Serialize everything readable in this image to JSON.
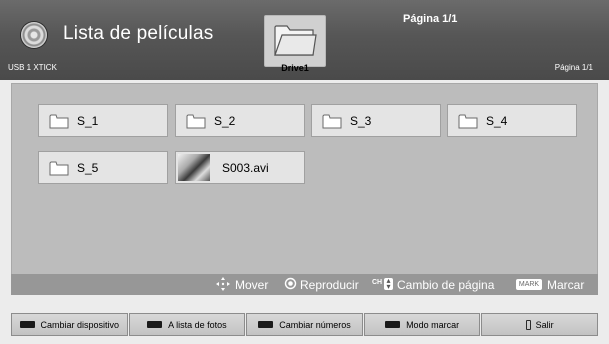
{
  "header": {
    "title": "Lista de películas",
    "page_indicator_top": "Página 1/1",
    "device": "USB 1 XTICK",
    "page_indicator_right": "Página 1/1",
    "drive_label": "Drive1"
  },
  "items": [
    {
      "label": "S_1",
      "type": "folder"
    },
    {
      "label": "S_2",
      "type": "folder"
    },
    {
      "label": "S_3",
      "type": "folder"
    },
    {
      "label": "S_4",
      "type": "folder"
    },
    {
      "label": "S_5",
      "type": "folder"
    },
    {
      "label": "S003.avi",
      "type": "video"
    }
  ],
  "hints": {
    "move": "Mover",
    "play": "Reproducir",
    "ch_badge": "CH",
    "page_change": "Cambio de página",
    "mark_badge": "MARK",
    "mark": "Marcar"
  },
  "buttons": [
    {
      "label": "Cambiar dispositivo"
    },
    {
      "label": "A lista de fotos"
    },
    {
      "label": "Cambiar números"
    },
    {
      "label": "Modo marcar"
    },
    {
      "label": "Salir"
    }
  ]
}
